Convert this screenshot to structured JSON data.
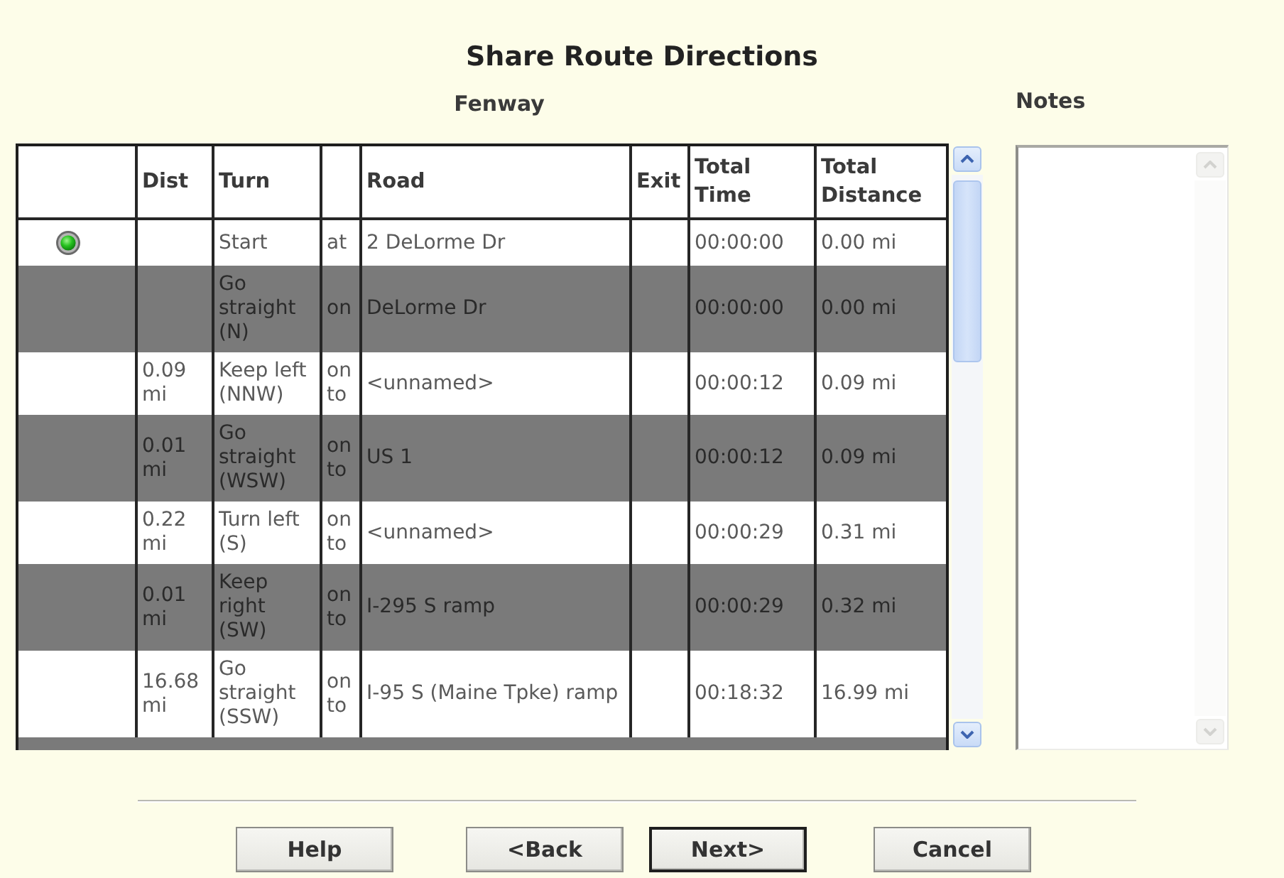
{
  "title": "Share Route Directions",
  "directions": {
    "route_name": "Fenway",
    "columns": {
      "dist": "Dist",
      "turn": "Turn",
      "road": "Road",
      "exit": "Exit",
      "total_time": "Total Time",
      "total_distance": "Total Distance"
    },
    "rows": [
      {
        "kind": "start",
        "turn": "Start",
        "column_4": "at",
        "road": "2 DeLorme Dr",
        "total_time": "00:00:00",
        "total_distance": "0.00 mi"
      },
      {
        "kind": "step",
        "turn": "Go straight (N)",
        "column_4": "on",
        "road": "DeLorme Dr",
        "total_time": "00:00:00",
        "total_distance": "0.00 mi"
      },
      {
        "kind": "step",
        "dist": "0.09 mi",
        "turn": "Keep left (NNW)",
        "column_4": "on to",
        "road": "<unnamed>",
        "total_time": "00:00:12",
        "total_distance": "0.09 mi"
      },
      {
        "kind": "step",
        "dist": "0.01 mi",
        "turn": "Go straight (WSW)",
        "column_4": "on to",
        "road": "US 1",
        "total_time": "00:00:12",
        "total_distance": "0.09 mi"
      },
      {
        "kind": "step",
        "dist": "0.22 mi",
        "turn": "Turn left (S)",
        "column_4": "on to",
        "road": "<unnamed>",
        "total_time": "00:00:29",
        "total_distance": "0.31 mi"
      },
      {
        "kind": "step",
        "dist": "0.01 mi",
        "turn": "Keep right (SW)",
        "column_4": "on to",
        "road": "I-295 S ramp",
        "total_time": "00:00:29",
        "total_distance": "0.32 mi"
      },
      {
        "kind": "step",
        "dist": "16.68 mi",
        "turn": "Go straight (SSW)",
        "column_4": "on to",
        "road": "I-95 S (Maine Tpke) ramp",
        "total_time": "00:18:32",
        "total_distance": "16.99 mi"
      }
    ]
  },
  "notes": {
    "label": "Notes"
  },
  "buttons": [
    {
      "label": "Help",
      "default": false
    },
    {
      "label": "<Back",
      "default": false
    },
    {
      "label": "Next>",
      "default": true
    },
    {
      "label": "Cancel",
      "default": false
    }
  ]
}
